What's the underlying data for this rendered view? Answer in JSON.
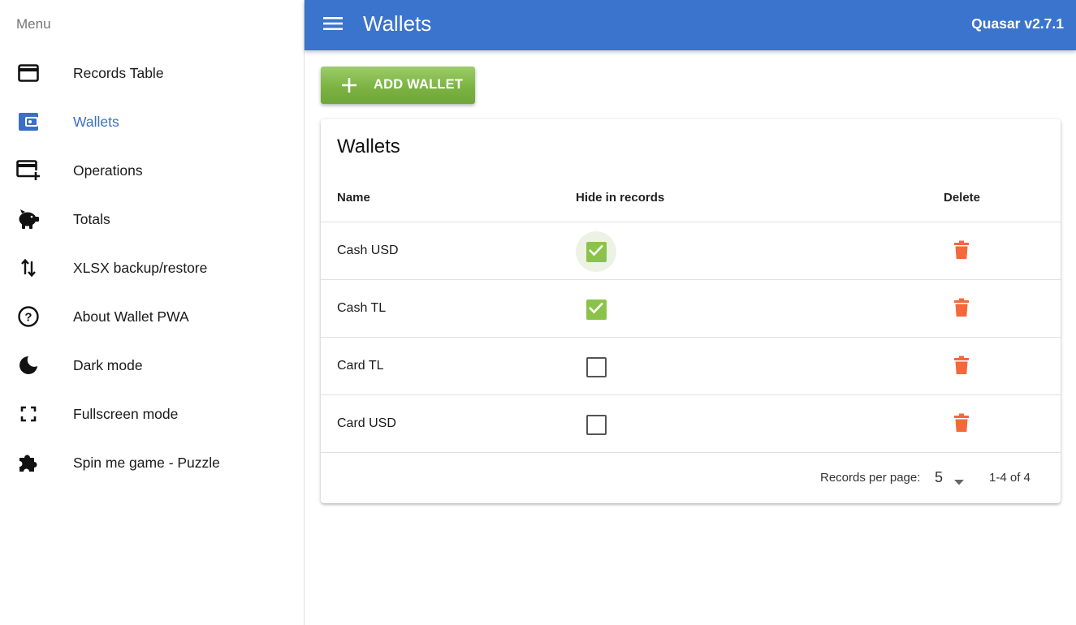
{
  "drawer": {
    "header": "Menu",
    "items": [
      {
        "label": "Records Table",
        "icon": "credit-card-icon"
      },
      {
        "label": "Wallets",
        "icon": "wallet-icon"
      },
      {
        "label": "Operations",
        "icon": "add-card-icon"
      },
      {
        "label": "Totals",
        "icon": "piggy-bank-icon"
      },
      {
        "label": "XLSX backup/restore",
        "icon": "swap-vert-icon"
      },
      {
        "label": "About Wallet PWA",
        "icon": "help-circle-icon"
      },
      {
        "label": "Dark mode",
        "icon": "moon-icon"
      },
      {
        "label": "Fullscreen mode",
        "icon": "fullscreen-icon"
      },
      {
        "label": "Spin me game - Puzzle",
        "icon": "puzzle-icon"
      }
    ],
    "active_index": 1
  },
  "header": {
    "title": "Wallets",
    "version": "Quasar v2.7.1"
  },
  "toolbar": {
    "add_label": "ADD WALLET"
  },
  "table": {
    "title": "Wallets",
    "columns": {
      "name": "Name",
      "hide": "Hide in records",
      "delete": "Delete"
    },
    "rows": [
      {
        "name": "Cash USD",
        "hidden": true
      },
      {
        "name": "Cash TL",
        "hidden": true
      },
      {
        "name": "Card TL",
        "hidden": false
      },
      {
        "name": "Card USD",
        "hidden": false
      }
    ],
    "footer": {
      "rows_per_page_label": "Records per page:",
      "rows_per_page": "5",
      "range": "1-4 of 4"
    }
  },
  "colors": {
    "header": "#3a74cd",
    "active": "#3a6fc8",
    "accent_green": "#8bc34a",
    "delete_orange": "#f4683a"
  }
}
